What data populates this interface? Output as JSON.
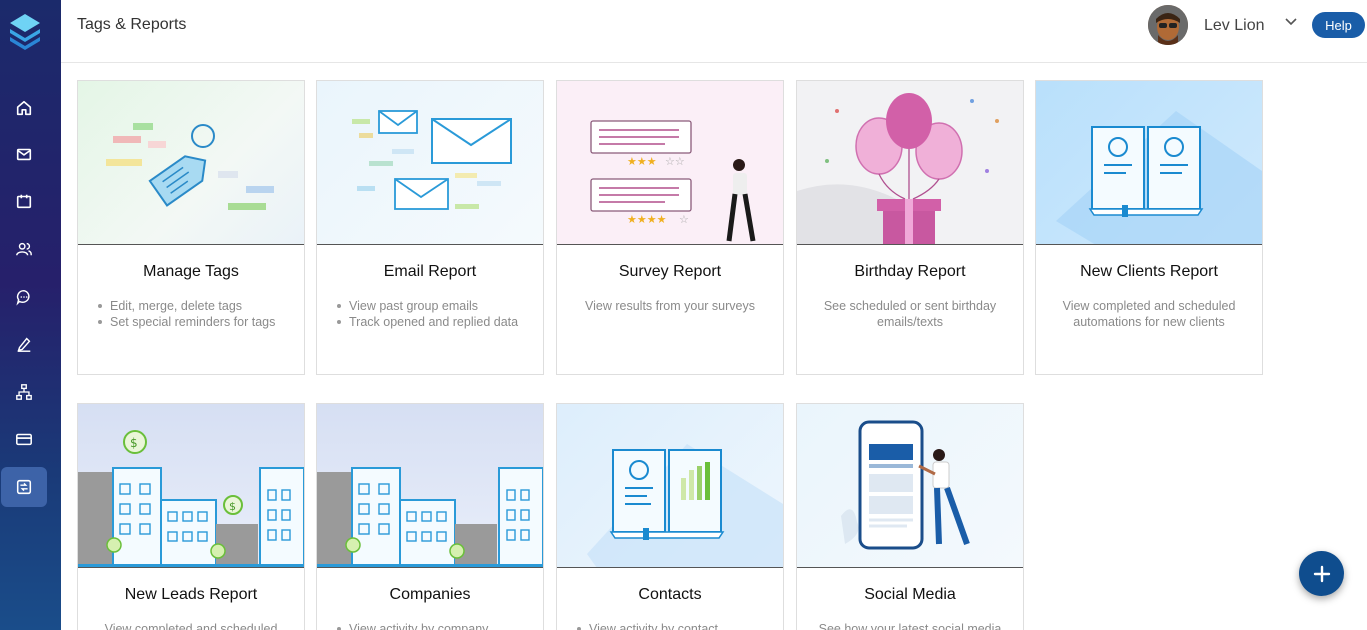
{
  "header": {
    "title": "Tags & Reports",
    "user_name": "Lev Lion",
    "help_label": "Help"
  },
  "sidebar": {
    "items": [
      {
        "icon": "home-icon"
      },
      {
        "icon": "mail-icon"
      },
      {
        "icon": "calendar-icon"
      },
      {
        "icon": "users-icon"
      },
      {
        "icon": "chat-icon"
      },
      {
        "icon": "edit-icon"
      },
      {
        "icon": "hierarchy-icon"
      },
      {
        "icon": "card-icon"
      },
      {
        "icon": "reports-icon",
        "active": true
      }
    ]
  },
  "cards": [
    {
      "title": "Manage Tags",
      "bullets": [
        "Edit, merge, delete tags",
        "Set special reminders for tags"
      ]
    },
    {
      "title": "Email Report",
      "bullets": [
        "View past group emails",
        "Track opened and replied data"
      ]
    },
    {
      "title": "Survey Report",
      "text": "View results from your surveys"
    },
    {
      "title": "Birthday Report",
      "text": "See scheduled or sent birthday emails/texts"
    },
    {
      "title": "New Clients Report",
      "text": "View completed and scheduled automations for new clients"
    },
    {
      "title": "New Leads Report",
      "text": "View completed and scheduled"
    },
    {
      "title": "Companies",
      "bullets": [
        "View activity by company"
      ]
    },
    {
      "title": "Contacts",
      "bullets": [
        "View activity by contact"
      ]
    },
    {
      "title": "Social Media",
      "text": "See how your latest social media"
    }
  ],
  "colors": {
    "accent": "#1a5da8",
    "sidebar_top": "#1b2a6b",
    "fab": "#0f4d8e"
  }
}
